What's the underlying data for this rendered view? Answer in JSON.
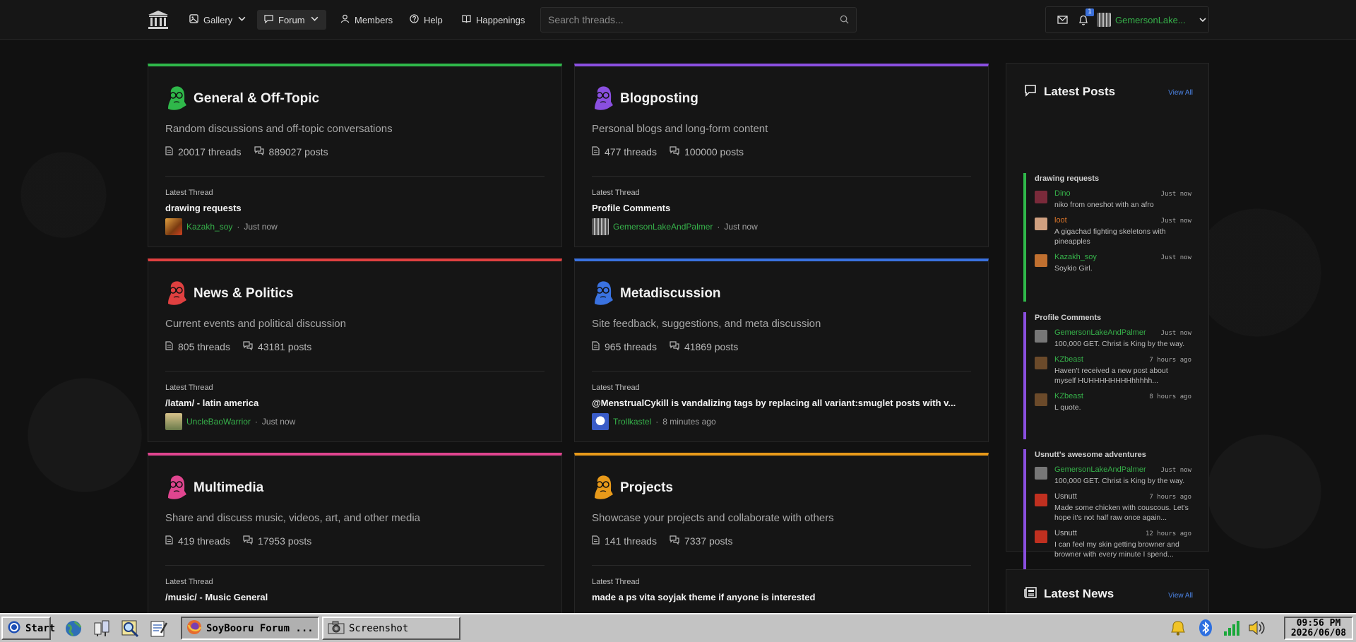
{
  "nav": {
    "items": [
      {
        "label": "Gallery",
        "icon": "image-icon",
        "dropdown": true
      },
      {
        "label": "Forum",
        "icon": "chat-icon",
        "dropdown": true,
        "active": true
      },
      {
        "label": "Members",
        "icon": "user-icon"
      },
      {
        "label": "Help",
        "icon": "help-icon"
      },
      {
        "label": "Happenings",
        "icon": "book-icon"
      }
    ],
    "search_placeholder": "Search threads...",
    "notification_count": "1",
    "username": "GemersonLake..."
  },
  "categories": [
    {
      "title": "General & Off-Topic",
      "description": "Random discussions and off-topic conversations",
      "threads": "20017 threads",
      "posts": "889027 posts",
      "latest_label": "Latest Thread",
      "latest_title": "drawing requests",
      "latest_user": "Kazakh_soy",
      "latest_time": "Just now",
      "color": "#2fb84a"
    },
    {
      "title": "Blogposting",
      "description": "Personal blogs and long-form content",
      "threads": "477 threads",
      "posts": "100000 posts",
      "latest_label": "Latest Thread",
      "latest_title": "Profile Comments",
      "latest_user": "GemersonLakeAndPalmer",
      "latest_time": "Just now",
      "color": "#8a4fe0"
    },
    {
      "title": "News & Politics",
      "description": "Current events and political discussion",
      "threads": "805 threads",
      "posts": "43181 posts",
      "latest_label": "Latest Thread",
      "latest_title": "/latam/ - latin america",
      "latest_user": "UncleBaoWarrior",
      "latest_time": "Just now",
      "color": "#e04040"
    },
    {
      "title": "Metadiscussion",
      "description": "Site feedback, suggestions, and meta discussion",
      "threads": "965 threads",
      "posts": "41869 posts",
      "latest_label": "Latest Thread",
      "latest_title": "@MenstrualCykill is vandalizing tags by replacing all variant:smuglet posts with v...",
      "latest_user": "Trollkastel",
      "latest_time": "8 minutes ago",
      "color": "#3a72e0"
    },
    {
      "title": "Multimedia",
      "description": "Share and discuss music, videos, art, and other media",
      "threads": "419 threads",
      "posts": "17953 posts",
      "latest_label": "Latest Thread",
      "latest_title": "/music/ - Music General",
      "latest_user": "",
      "latest_time": "",
      "color": "#e0458f"
    },
    {
      "title": "Projects",
      "description": "Showcase your projects and collaborate with others",
      "threads": "141 threads",
      "posts": "7337 posts",
      "latest_label": "Latest Thread",
      "latest_title": "made a ps vita soyjak theme if anyone is interested",
      "latest_user": "",
      "latest_time": "",
      "color": "#e89a1a"
    }
  ],
  "sidebar": {
    "title": "Latest Posts",
    "view_all": "View All",
    "groups": [
      {
        "thread": "drawing requests",
        "color": "#2fb84a",
        "posts": [
          {
            "user": "Dino",
            "user_color": "#36b14a",
            "time": "Just now",
            "text": "niko from oneshot with an afro"
          },
          {
            "user": "loot",
            "user_color": "#e0772a",
            "time": "Just now",
            "text": "A gigachad fighting skeletons with pineapples"
          },
          {
            "user": "Kazakh_soy",
            "user_color": "#36b14a",
            "time": "Just now",
            "text": "Soykio Girl."
          }
        ]
      },
      {
        "thread": "Profile Comments",
        "color": "#8a4fe0",
        "posts": [
          {
            "user": "GemersonLakeAndPalmer",
            "user_color": "#36b14a",
            "time": "Just now",
            "text": "100,000 GET. Christ is King by the way."
          },
          {
            "user": "KZbeast",
            "user_color": "#36b14a",
            "time": "7 hours ago",
            "text": "Haven't received a new post about myself HUHHHHHHHHhhhhh..."
          },
          {
            "user": "KZbeast",
            "user_color": "#36b14a",
            "time": "8 hours ago",
            "text": "L quote."
          }
        ]
      },
      {
        "thread": "Usnutt's awesome adventures",
        "color": "#8a4fe0",
        "posts": [
          {
            "user": "GemersonLakeAndPalmer",
            "user_color": "#36b14a",
            "time": "Just now",
            "text": "100,000 GET. Christ is King by the way."
          },
          {
            "user": "Usnutt",
            "user_color": "#bdbdbd",
            "time": "7 hours ago",
            "text": "Made some chicken with couscous. Let's hope it's not half raw once again..."
          },
          {
            "user": "Usnutt",
            "user_color": "#bdbdbd",
            "time": "12 hours ago",
            "text": "I can feel my skin getting browner and browner with every minute I spend..."
          }
        ]
      }
    ],
    "news_title": "Latest News",
    "news_view_all": "View All"
  },
  "taskbar": {
    "start": "Start",
    "window1": "SoyBooru Forum ...",
    "window2": "Screenshot",
    "time": "09:56 PM",
    "date": "2026/06/08"
  }
}
